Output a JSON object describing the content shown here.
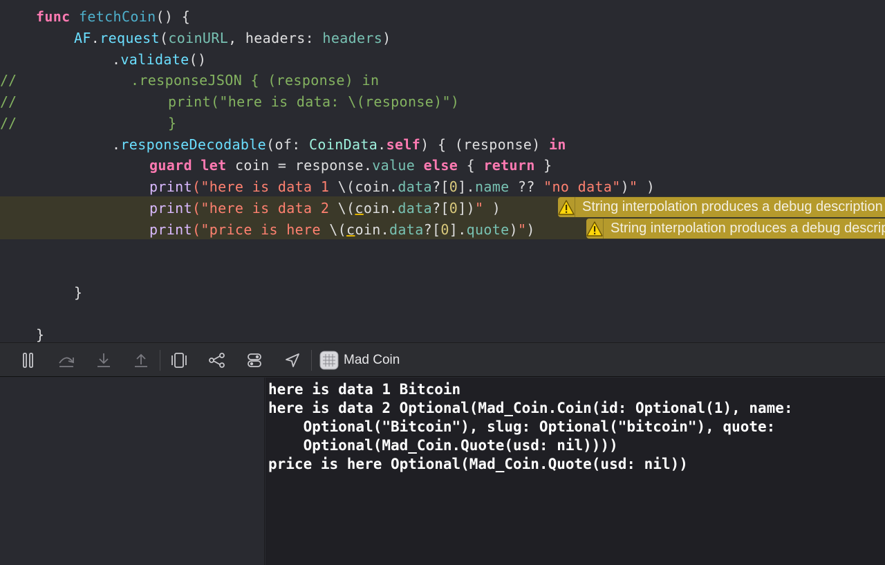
{
  "editor": {
    "warning_message": "String interpolation produces a debug description for an optional value; did you mean to make this explicit?"
  },
  "debugbar": {
    "target_label": "Mad Coin",
    "buttons": [
      "pause",
      "step-over",
      "step-into",
      "step-out",
      "view-hierarchy",
      "memory-graph",
      "environment-overrides",
      "simulate-location"
    ]
  },
  "console": {
    "lines": [
      "here is data 1 Bitcoin",
      "here is data 2 Optional(Mad_Coin.Coin(id: Optional(1), name:",
      "    Optional(\"Bitcoin\"), slug: Optional(\"bitcoin\"), quote:",
      "    Optional(Mad_Coin.Quote(usd: nil))))",
      "price is here Optional(Mad_Coin.Quote(usd: nil))"
    ]
  },
  "colors": {
    "editor_bg": "#292a30",
    "keyword": "#ff7ab2",
    "string": "#ff8170",
    "comment": "#84b360",
    "warning_banner": "#b59a2c",
    "highlight_line": "#3b3929"
  }
}
